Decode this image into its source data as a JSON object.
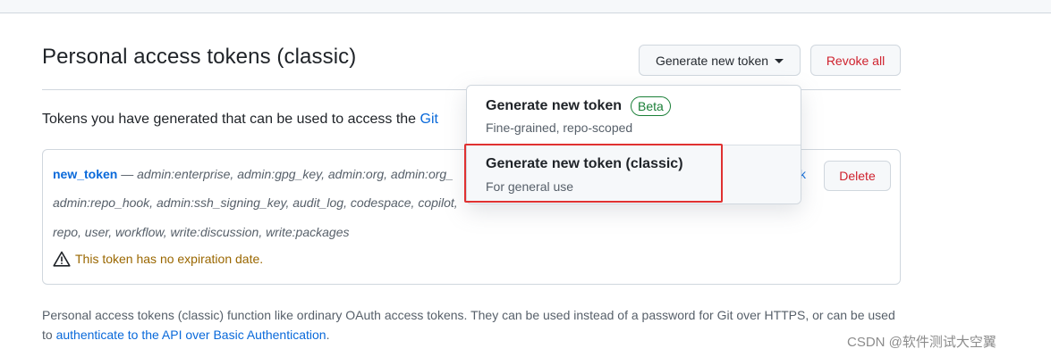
{
  "page": {
    "title": "Personal access tokens (classic)"
  },
  "header": {
    "generate_button_label": "Generate new token",
    "revoke_button_label": "Revoke all"
  },
  "description": {
    "text_before_link": "Tokens you have generated that can be used to access the ",
    "link_text": "Git"
  },
  "token": {
    "name": "new_token",
    "separator": " — ",
    "scopes_line1": "admin:enterprise, admin:gpg_key, admin:org, admin:org_",
    "scopes_line2": "admin:repo_hook, admin:ssh_signing_key, audit_log, codespace, copilot,",
    "scopes_line3": "repo, user, workflow, write:discussion, write:packages",
    "warning": "This token has no expiration date.",
    "partial_link": "k",
    "delete_label": "Delete"
  },
  "dropdown": {
    "items": [
      {
        "title": "Generate new token",
        "badge": "Beta",
        "subtitle": "Fine-grained, repo-scoped"
      },
      {
        "title": "Generate new token (classic)",
        "subtitle": "For general use"
      }
    ]
  },
  "footer": {
    "text_before_link": "Personal access tokens (classic) function like ordinary OAuth access tokens. They can be used instead of a password for Git over HTTPS, or can be used to ",
    "link_text": "authenticate to the API over Basic Authentication",
    "text_after_link": "."
  },
  "watermark": "CSDN @软件测试大空翼",
  "colors": {
    "link": "#0969da",
    "danger": "#cf222e",
    "success": "#1a7f37",
    "warning": "#9a6700",
    "highlight": "#e03131"
  }
}
